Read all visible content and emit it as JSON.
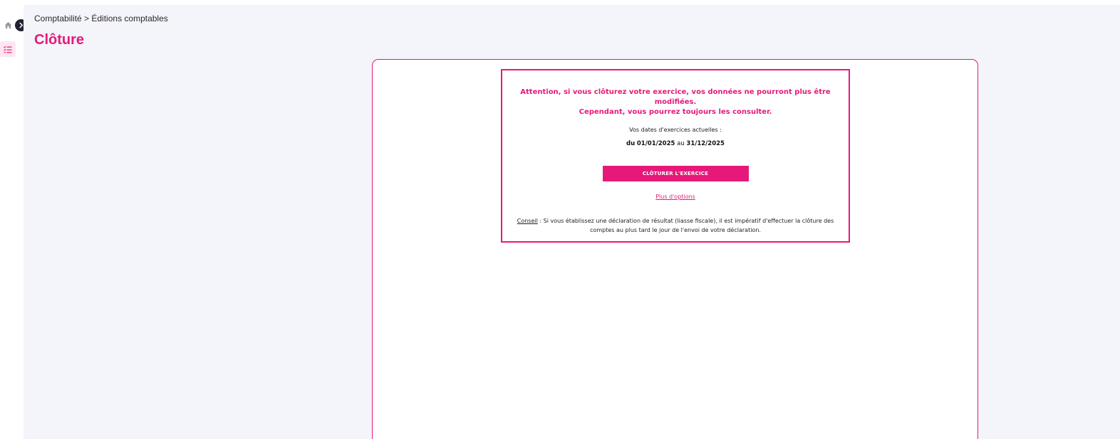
{
  "sidebar": {
    "items": [
      {
        "icon": "home-icon"
      },
      {
        "icon": "checklist-icon"
      }
    ],
    "toggle_icon": "chevron-right-icon"
  },
  "breadcrumb": "Comptabilité > Éditions comptables",
  "page_title": "Clôture",
  "notice": {
    "warning_line1": "Attention, si vous clôturez votre exercice, vos données ne pourront plus être modifiées.",
    "warning_line2": "Cependant, vous pourrez toujours les consulter.",
    "dates_label": "Vos dates d'exercices actuelles :",
    "dates_from_prefix": "du",
    "date_start": "01/01/2025",
    "dates_to_prefix": "au",
    "date_end": "31/12/2025",
    "close_button": "CLÔTURER L'EXERCICE",
    "more_options": "Plus d'options",
    "advice_label": "Conseil",
    "advice_text": " : Si vous établissez une déclaration de résultat (liasse fiscale), il est impératif d'effectuer la clôture des comptes au plus tard le jour de l'envoi de votre déclaration."
  },
  "colors": {
    "accent": "#e6197a",
    "background": "#f4f4fb",
    "toggle": "#1f2330"
  }
}
